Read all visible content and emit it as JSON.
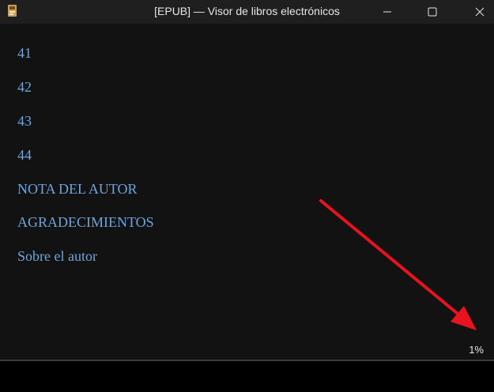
{
  "window": {
    "title": "[EPUB] — Visor de libros electrónicos",
    "controls": {
      "minimize": "minimize-icon",
      "maximize": "maximize-icon",
      "close": "close-icon"
    }
  },
  "toc": {
    "items": [
      {
        "label": "41"
      },
      {
        "label": "42"
      },
      {
        "label": "43"
      },
      {
        "label": "44"
      },
      {
        "label": "NOTA DEL AUTOR"
      },
      {
        "label": "AGRADECIMIENTOS"
      },
      {
        "label": "Sobre el autor"
      }
    ]
  },
  "status": {
    "progress_text": "1%",
    "progress_value": 0.01
  },
  "annotation": {
    "arrow_color": "#e8131f"
  },
  "colors": {
    "link": "#6ea5dc",
    "background": "#121212",
    "titlebar": "#1f1f1f"
  }
}
